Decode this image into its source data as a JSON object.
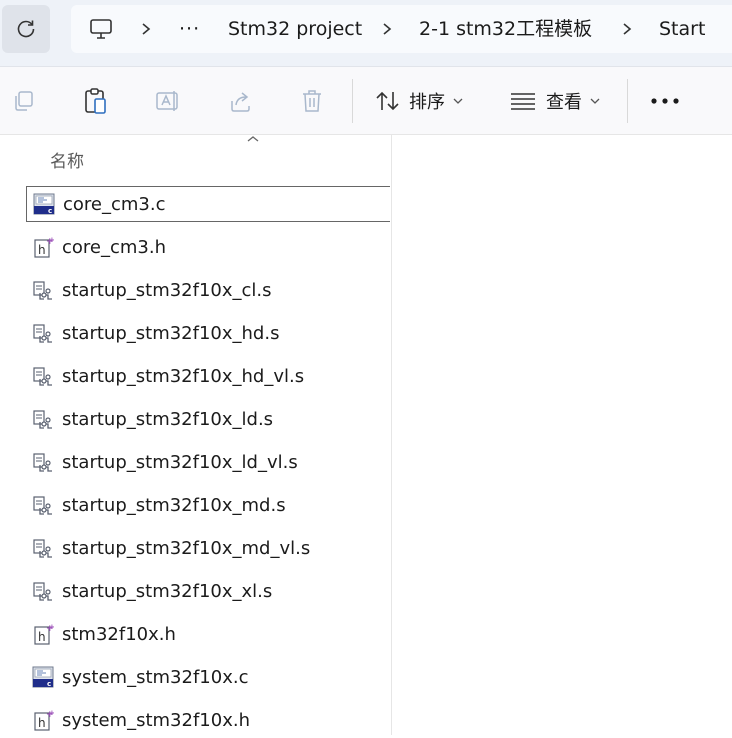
{
  "address_bar": {
    "breadcrumbs": [
      "Stm32 project",
      "2-1 stm32工程模板",
      "Start"
    ],
    "refresh_icon": "refresh-icon",
    "computer_icon": "computer-icon",
    "overflow_label": "···"
  },
  "command_bar": {
    "sort_label": "排序",
    "view_label": "查看",
    "more_label": "···"
  },
  "file_list": {
    "column_name": "名称",
    "files": [
      {
        "name": "core_cm3.c",
        "icon": "c-file-icon"
      },
      {
        "name": "core_cm3.h",
        "icon": "h-file-icon"
      },
      {
        "name": "startup_stm32f10x_cl.s",
        "icon": "asm-file-icon"
      },
      {
        "name": "startup_stm32f10x_hd.s",
        "icon": "asm-file-icon"
      },
      {
        "name": "startup_stm32f10x_hd_vl.s",
        "icon": "asm-file-icon"
      },
      {
        "name": "startup_stm32f10x_ld.s",
        "icon": "asm-file-icon"
      },
      {
        "name": "startup_stm32f10x_ld_vl.s",
        "icon": "asm-file-icon"
      },
      {
        "name": "startup_stm32f10x_md.s",
        "icon": "asm-file-icon"
      },
      {
        "name": "startup_stm32f10x_md_vl.s",
        "icon": "asm-file-icon"
      },
      {
        "name": "startup_stm32f10x_xl.s",
        "icon": "asm-file-icon"
      },
      {
        "name": "stm32f10x.h",
        "icon": "h-file-icon"
      },
      {
        "name": "system_stm32f10x.c",
        "icon": "c-file-icon"
      },
      {
        "name": "system_stm32f10x.h",
        "icon": "h-file-icon"
      }
    ]
  }
}
